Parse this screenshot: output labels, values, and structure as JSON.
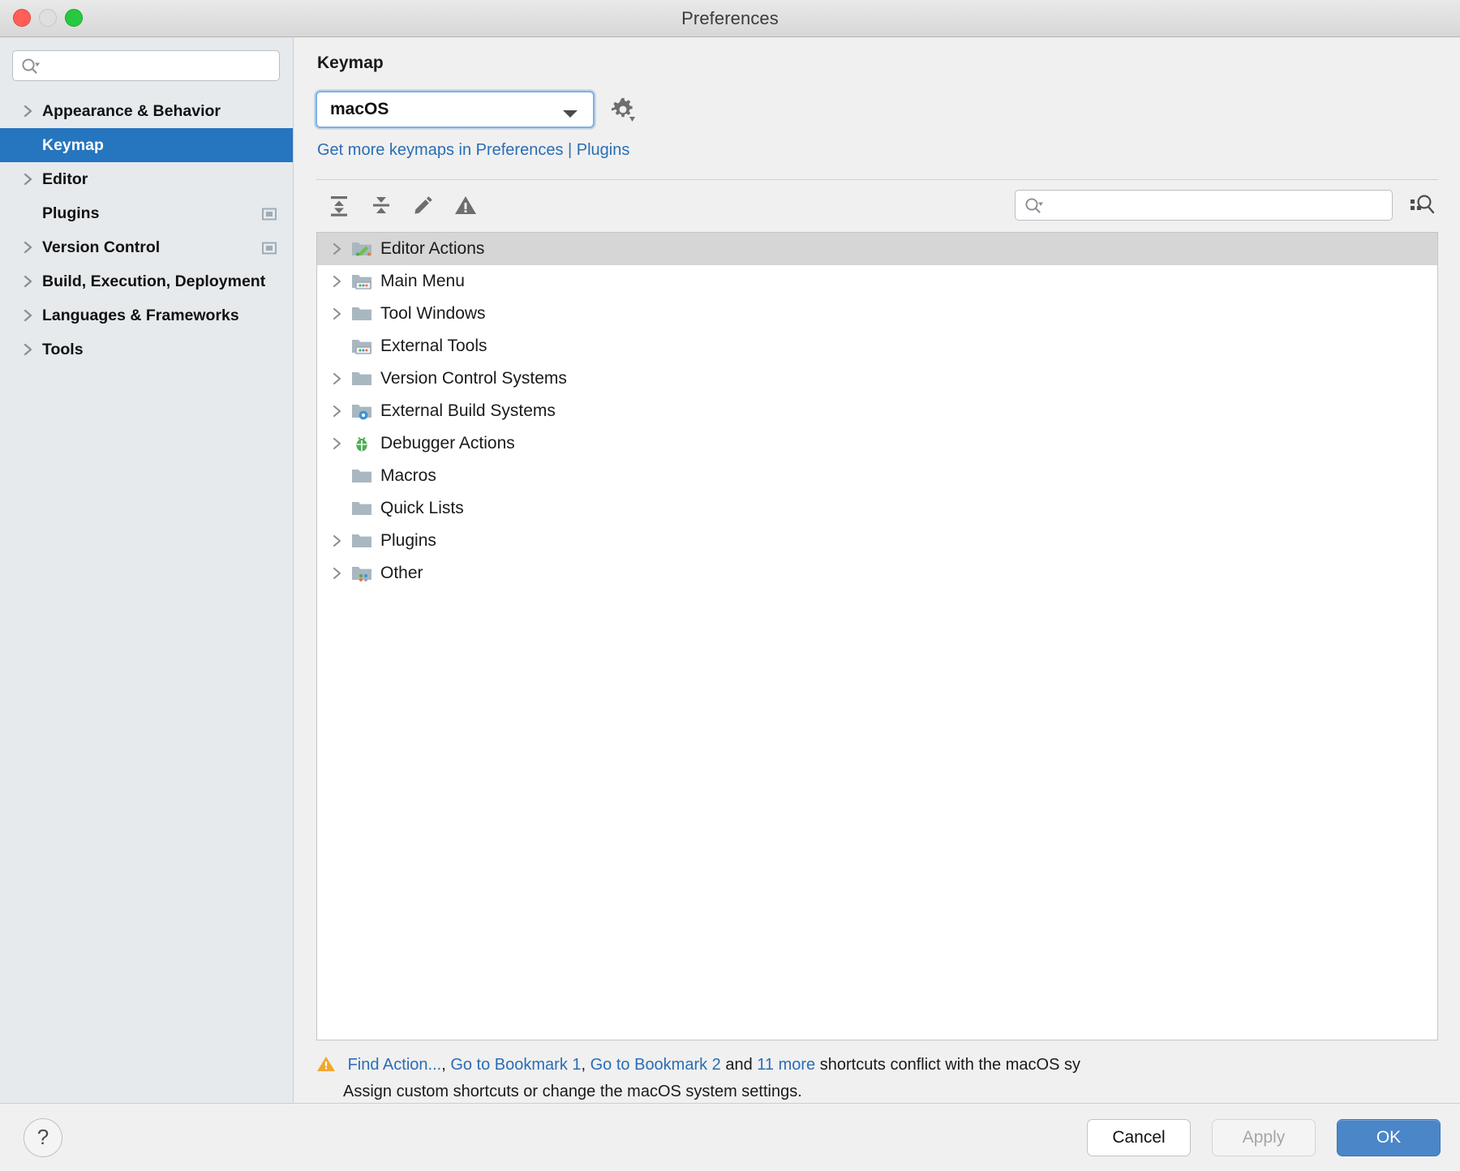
{
  "window": {
    "title": "Preferences",
    "traffic_lights": [
      "close-red",
      "minimize-yellow",
      "zoom-green"
    ]
  },
  "sidebar": {
    "search": {
      "value": "",
      "placeholder": ""
    },
    "items": [
      {
        "label": "Appearance & Behavior",
        "expandable": true,
        "selected": false,
        "badge": false
      },
      {
        "label": "Keymap",
        "expandable": false,
        "selected": true,
        "badge": false
      },
      {
        "label": "Editor",
        "expandable": true,
        "selected": false,
        "badge": false
      },
      {
        "label": "Plugins",
        "expandable": false,
        "selected": false,
        "badge": true
      },
      {
        "label": "Version Control",
        "expandable": true,
        "selected": false,
        "badge": true
      },
      {
        "label": "Build, Execution, Deployment",
        "expandable": true,
        "selected": false,
        "badge": false
      },
      {
        "label": "Languages & Frameworks",
        "expandable": true,
        "selected": false,
        "badge": false
      },
      {
        "label": "Tools",
        "expandable": true,
        "selected": false,
        "badge": false
      }
    ]
  },
  "main": {
    "page_title": "Keymap",
    "keymap_select": {
      "value": "macOS"
    },
    "settings_gear_tooltip": "Keymap settings",
    "get_more_link": "Get more keymaps in Preferences | Plugins",
    "toolbar": {
      "expand_all": "expand-all-icon",
      "collapse_all": "collapse-all-icon",
      "edit_shortcut": "pencil-icon",
      "show_conflicts": "warning-icon"
    },
    "tree_search": {
      "value": "",
      "placeholder": ""
    },
    "find_by_shortcut": "find-by-shortcut-icon",
    "tree": [
      {
        "label": "Editor Actions",
        "icon": "folder-editor-icon",
        "expandable": true,
        "selected": true
      },
      {
        "label": "Main Menu",
        "icon": "folder-menu-icon",
        "expandable": true,
        "selected": false
      },
      {
        "label": "Tool Windows",
        "icon": "folder-icon",
        "expandable": true,
        "selected": false
      },
      {
        "label": "External Tools",
        "icon": "folder-menu-icon",
        "expandable": false,
        "selected": false
      },
      {
        "label": "Version Control Systems",
        "icon": "folder-icon",
        "expandable": true,
        "selected": false
      },
      {
        "label": "External Build Systems",
        "icon": "folder-gear-icon",
        "expandable": true,
        "selected": false
      },
      {
        "label": "Debugger Actions",
        "icon": "bug-icon",
        "expandable": true,
        "selected": false
      },
      {
        "label": "Macros",
        "icon": "folder-icon",
        "expandable": false,
        "selected": false
      },
      {
        "label": "Quick Lists",
        "icon": "folder-icon",
        "expandable": false,
        "selected": false
      },
      {
        "label": "Plugins",
        "icon": "folder-icon",
        "expandable": true,
        "selected": false
      },
      {
        "label": "Other",
        "icon": "folder-dots-icon",
        "expandable": true,
        "selected": false
      }
    ],
    "conflict": {
      "icon": "warning-triangle-icon",
      "link1": "Find Action...",
      "sep1": ", ",
      "link2": "Go to Bookmark 1",
      "sep2": ", ",
      "link3": "Go to Bookmark 2",
      "mid": " and ",
      "link4": "11 more",
      "tail": " shortcuts conflict with the macOS sy",
      "line2": "Assign custom shortcuts or change the macOS system settings."
    }
  },
  "footer": {
    "help": "?",
    "cancel": "Cancel",
    "apply": "Apply",
    "ok": "OK"
  },
  "colors": {
    "accent_blue": "#2675bf",
    "link_blue": "#2a6db5",
    "primary_button": "#4a86c8",
    "warning_orange": "#f0a732",
    "sidebar_bg": "#e6eaed",
    "panel_bg": "#f0f0f0"
  }
}
